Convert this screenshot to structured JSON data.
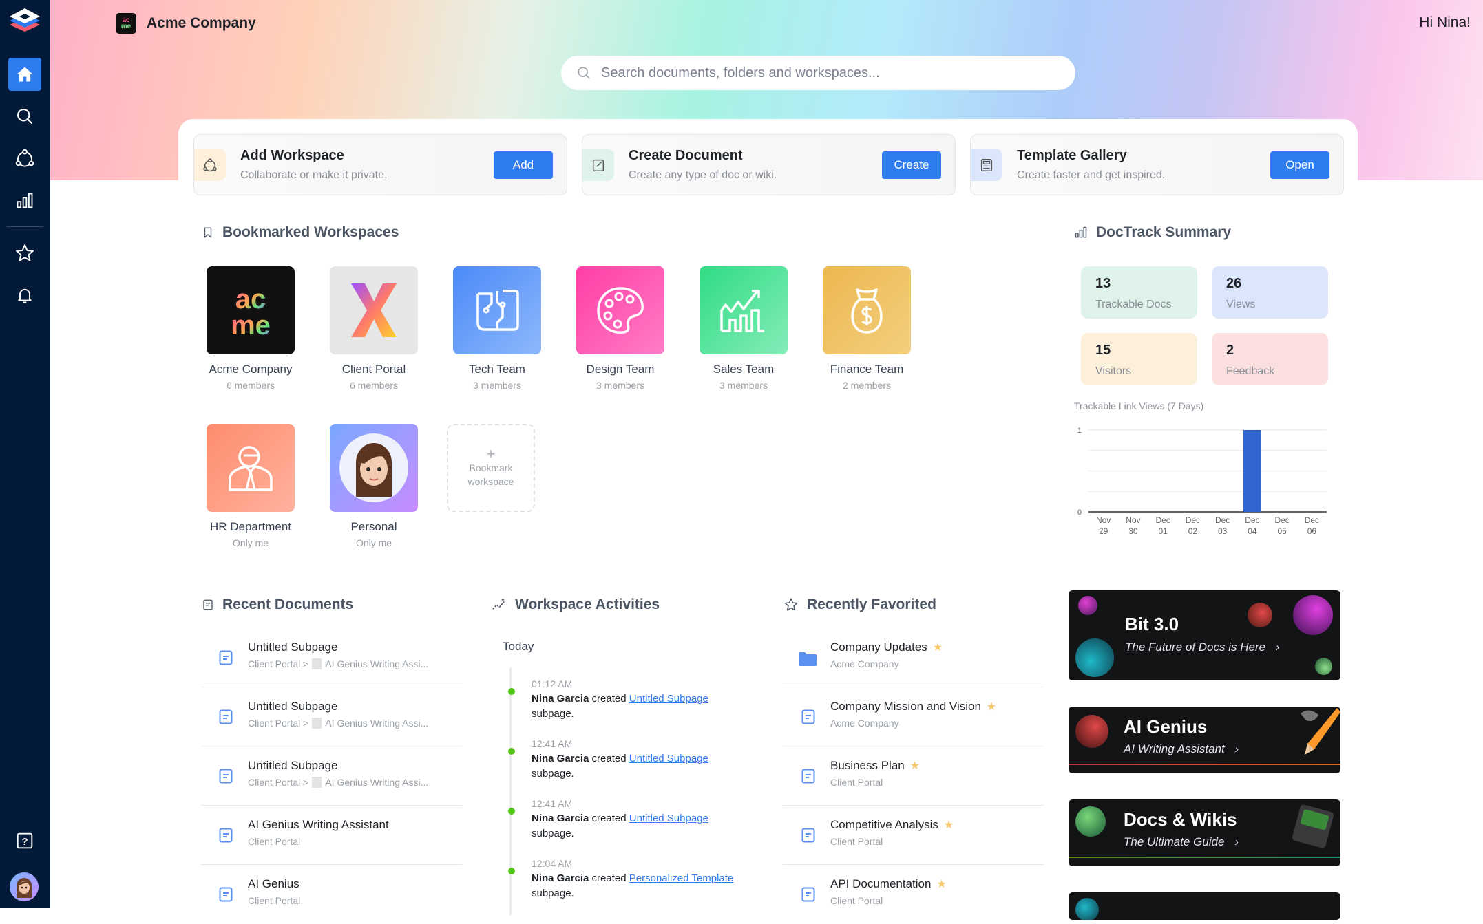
{
  "app": {
    "company": "Acme Company",
    "greeting": "Hi Nina!"
  },
  "sidebar": {
    "items": [
      {
        "name": "home",
        "active": true
      },
      {
        "name": "search"
      },
      {
        "name": "workspaces"
      },
      {
        "name": "doctrack"
      },
      {
        "name": "favorites"
      },
      {
        "name": "notifications"
      },
      {
        "name": "help"
      }
    ]
  },
  "search": {
    "placeholder": "Search documents, folders and workspaces..."
  },
  "actions": [
    {
      "title": "Add Workspace",
      "subtitle": "Collaborate or make it private.",
      "button": "Add",
      "icon_bg": "#fdf0da"
    },
    {
      "title": "Create Document",
      "subtitle": "Create any type of doc or wiki.",
      "button": "Create",
      "icon_bg": "#dff3ea"
    },
    {
      "title": "Template Gallery",
      "subtitle": "Create faster and get inspired.",
      "button": "Open",
      "icon_bg": "#dbe5fb"
    }
  ],
  "bookmarked": {
    "title": "Bookmarked Workspaces",
    "items": [
      {
        "name": "Acme Company",
        "sub": "6 members"
      },
      {
        "name": "Client Portal",
        "sub": "6 members"
      },
      {
        "name": "Tech Team",
        "sub": "3 members"
      },
      {
        "name": "Design Team",
        "sub": "3 members"
      },
      {
        "name": "Sales Team",
        "sub": "3 members"
      },
      {
        "name": "Finance Team",
        "sub": "2 members"
      },
      {
        "name": "HR Department",
        "sub": "Only me"
      },
      {
        "name": "Personal",
        "sub": "Only me"
      }
    ],
    "add_line1": "Bookmark",
    "add_line2": "workspace"
  },
  "doctrack": {
    "title": "DocTrack Summary",
    "stats": [
      {
        "value": "13",
        "label": "Trackable Docs",
        "color": "#dff3ea"
      },
      {
        "value": "26",
        "label": "Views",
        "color": "#dbe5fb"
      },
      {
        "value": "15",
        "label": "Visitors",
        "color": "#fdf0da"
      },
      {
        "value": "2",
        "label": "Feedback",
        "color": "#fce0df"
      }
    ],
    "chart_title": "Trackable Link Views (7 Days)"
  },
  "chart_data": {
    "type": "bar",
    "title": "Trackable Link Views (7 Days)",
    "categories": [
      "Nov 29",
      "Nov 30",
      "Dec 01",
      "Dec 02",
      "Dec 03",
      "Dec 04",
      "Dec 05",
      "Dec 06"
    ],
    "values": [
      0,
      0,
      0,
      0,
      0,
      1,
      0,
      0
    ],
    "yticks": [
      "0",
      "1"
    ],
    "ylim": [
      0,
      1
    ],
    "color": "#3166d0",
    "grid": true
  },
  "recent_documents": {
    "title": "Recent Documents",
    "items": [
      {
        "title": "Untitled Subpage",
        "path": "Client Portal >",
        "parent": "AI Genius Writing Assi..."
      },
      {
        "title": "Untitled Subpage",
        "path": "Client Portal >",
        "parent": "AI Genius Writing Assi..."
      },
      {
        "title": "Untitled Subpage",
        "path": "Client Portal >",
        "parent": "AI Genius Writing Assi..."
      },
      {
        "title": "AI Genius Writing Assistant",
        "path": "Client Portal",
        "parent": ""
      },
      {
        "title": "AI Genius",
        "path": "Client Portal",
        "parent": ""
      }
    ]
  },
  "activities": {
    "title": "Workspace Activities",
    "group": "Today",
    "items": [
      {
        "time": "01:12 AM",
        "user": "Nina Garcia",
        "verb": "created",
        "link": "Untitled Subpage",
        "suffix": "subpage."
      },
      {
        "time": "12:41 AM",
        "user": "Nina Garcia",
        "verb": "created",
        "link": "Untitled Subpage",
        "suffix": "subpage."
      },
      {
        "time": "12:41 AM",
        "user": "Nina Garcia",
        "verb": "created",
        "link": "Untitled Subpage",
        "suffix": "subpage."
      },
      {
        "time": "12:04 AM",
        "user": "Nina Garcia",
        "verb": "created",
        "link": "Personalized Template",
        "suffix": "subpage."
      }
    ]
  },
  "favorites": {
    "title": "Recently Favorited",
    "items": [
      {
        "title": "Company Updates",
        "sub": "Acme Company",
        "type": "folder"
      },
      {
        "title": "Company Mission and Vision",
        "sub": "Acme Company",
        "type": "doc"
      },
      {
        "title": "Business Plan",
        "sub": "Client Portal",
        "type": "doc"
      },
      {
        "title": "Competitive Analysis",
        "sub": "Client Portal",
        "type": "doc"
      },
      {
        "title": "API Documentation",
        "sub": "Client Portal",
        "type": "doc"
      }
    ]
  },
  "promos": [
    {
      "title": "Bit 3.0",
      "subtitle": "The Future of Docs is Here"
    },
    {
      "title": "AI Genius",
      "subtitle": "AI Writing Assistant"
    },
    {
      "title": "Docs & Wikis",
      "subtitle": "The Ultimate Guide"
    }
  ],
  "colors": {
    "accent": "#2f7bf0",
    "sidebar": "#031b38",
    "star": "#f5c86a",
    "timeline_dot": "#52c41a"
  }
}
